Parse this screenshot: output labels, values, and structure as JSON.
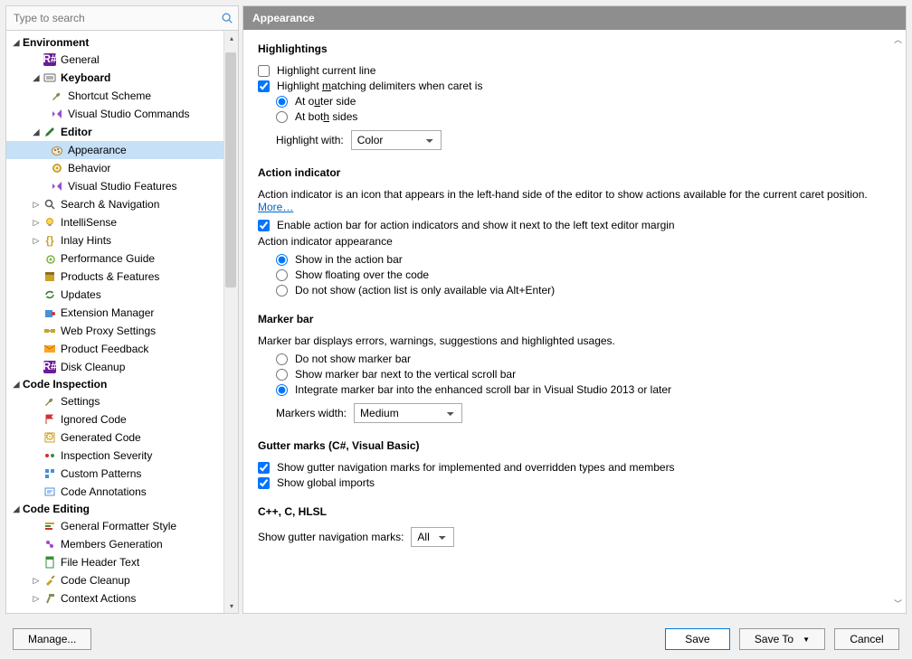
{
  "title": "Appearance",
  "search": {
    "placeholder": "Type to search"
  },
  "tree": {
    "environment": {
      "label": "Environment",
      "general": "General",
      "keyboard": "Keyboard",
      "shortcut_scheme": "Shortcut Scheme",
      "vs_commands": "Visual Studio Commands",
      "editor": "Editor",
      "appearance": "Appearance",
      "behavior": "Behavior",
      "vs_features": "Visual Studio Features",
      "search_nav": "Search & Navigation",
      "intellisense": "IntelliSense",
      "inlay_hints": "Inlay Hints",
      "perf_guide": "Performance Guide",
      "products": "Products & Features",
      "updates": "Updates",
      "ext_manager": "Extension Manager",
      "web_proxy": "Web Proxy Settings",
      "feedback": "Product Feedback",
      "disk_cleanup": "Disk Cleanup"
    },
    "code_inspection": {
      "label": "Code Inspection",
      "settings": "Settings",
      "ignored": "Ignored Code",
      "generated": "Generated Code",
      "severity": "Inspection Severity",
      "custom_patterns": "Custom Patterns",
      "annotations": "Code Annotations"
    },
    "code_editing": {
      "label": "Code Editing",
      "formatter": "General Formatter Style",
      "members": "Members Generation",
      "file_header": "File Header Text",
      "cleanup": "Code Cleanup",
      "context_actions": "Context Actions"
    }
  },
  "highlightings": {
    "heading": "Highlightings",
    "highlight_current_line": "Highlight current line",
    "highlight_matching_pre": "Highlight ",
    "highlight_matching_u": "m",
    "highlight_matching_post": "atching delimiters when caret is",
    "at_outer_pre": "At o",
    "at_outer_u": "u",
    "at_outer_post": "ter side",
    "at_both_pre": "At bot",
    "at_both_u": "h",
    "at_both_post": " sides",
    "highlight_with": "Highlight with:",
    "highlight_with_value": "Color"
  },
  "action_indicator": {
    "heading": "Action indicator",
    "desc": "Action indicator is an icon that appears in the left-hand side of the editor to show actions available for the current caret position.",
    "more": "More…",
    "enable_action_bar": "Enable action bar for action indicators and show it next to the left text editor margin",
    "appearance_label": "Action indicator appearance",
    "show_in_bar": "Show in the action bar",
    "show_floating": "Show floating over the code",
    "do_not_show": "Do not show (action list is only available via Alt+Enter)"
  },
  "marker_bar": {
    "heading": "Marker bar",
    "desc": "Marker bar displays errors, warnings, suggestions and highlighted usages.",
    "do_not_show": "Do not show marker bar",
    "next_to_scroll": "Show marker bar next to the vertical scroll bar",
    "integrate": "Integrate marker bar into the enhanced scroll bar in Visual Studio 2013 or later",
    "markers_width": "Markers width:",
    "markers_width_value": "Medium"
  },
  "gutter": {
    "heading": "Gutter marks (C#, Visual Basic)",
    "show_nav_marks": "Show gutter navigation marks for implemented and overridden types and members",
    "show_global_imports": "Show global imports"
  },
  "cpp": {
    "heading": "C++, C, HLSL",
    "show_gutter_nav": "Show gutter navigation marks:",
    "value": "All"
  },
  "footer": {
    "manage": "Manage...",
    "save": "Save",
    "save_to": "Save To",
    "cancel": "Cancel"
  }
}
